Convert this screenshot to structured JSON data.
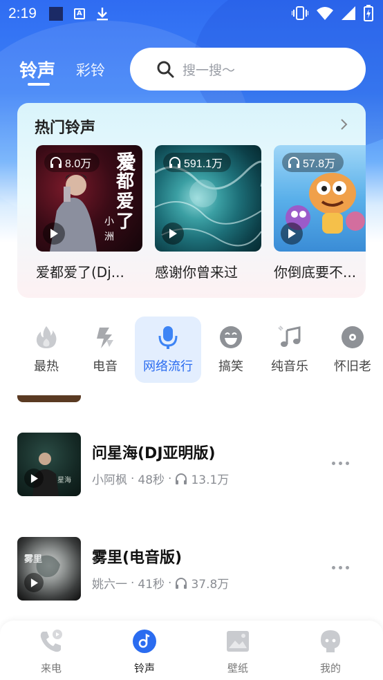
{
  "status_bar": {
    "time": "2:19"
  },
  "top_tabs": {
    "ringtone": "铃声",
    "crbt": "彩铃"
  },
  "search": {
    "placeholder": "搜一搜～"
  },
  "hot": {
    "title": "热门铃声",
    "items": [
      {
        "plays": "8.0万",
        "name": "爱都爱了(Dj...",
        "cover_text": "爱都爱了",
        "cover_sub": "小洲"
      },
      {
        "plays": "591.1万",
        "name": "感谢你曾来过"
      },
      {
        "plays": "57.8万",
        "name": "你倒底要不..."
      }
    ]
  },
  "categories": [
    {
      "label": "最热",
      "icon": "flame-icon"
    },
    {
      "label": "电音",
      "icon": "lightning-icon"
    },
    {
      "label": "网络流行",
      "icon": "microphone-icon",
      "active": true
    },
    {
      "label": "搞笑",
      "icon": "laugh-face-icon"
    },
    {
      "label": "纯音乐",
      "icon": "music-note-icon"
    },
    {
      "label": "怀旧老",
      "icon": "vinyl-disc-icon"
    }
  ],
  "songs": [
    {
      "title": "问星海(DJ亚明版)",
      "artist": "小阿枫",
      "duration": "48秒",
      "plays": "13.1万"
    },
    {
      "title": "雾里(电音版)",
      "artist": "姚六一",
      "duration": "41秒",
      "plays": "37.8万"
    }
  ],
  "bottom_nav": [
    {
      "label": "来电",
      "icon": "phone-icon"
    },
    {
      "label": "铃声",
      "icon": "ringtone-icon",
      "active": true
    },
    {
      "label": "壁纸",
      "icon": "wallpaper-icon"
    },
    {
      "label": "我的",
      "icon": "profile-icon"
    }
  ],
  "colors": {
    "accent": "#2a6cf0",
    "hero_top": "#2f6cf2"
  }
}
